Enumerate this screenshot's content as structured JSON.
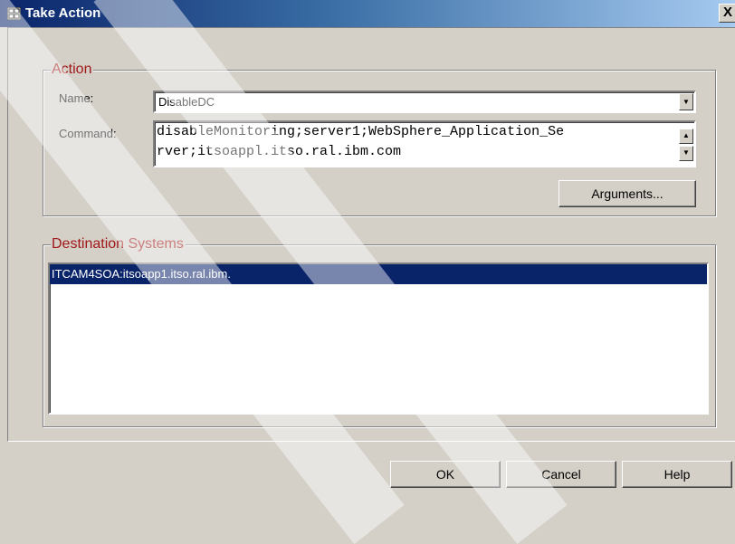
{
  "window": {
    "title": "Take Action",
    "close_glyph": "X"
  },
  "action_group": {
    "legend": "Action",
    "name_label": "Name:",
    "name_value": "DisableDC",
    "command_label": "Command:",
    "command_line1": "disableMonitoring;server1;WebSphere_Application_Se",
    "command_line2": "rver;itsoappl.itso.ral.ibm.com",
    "arguments_label": "Arguments..."
  },
  "destination_group": {
    "legend": "Destination Systems",
    "items": [
      "ITCAM4SOA:itsoapp1.itso.ral.ibm."
    ]
  },
  "buttons": {
    "ok": "OK",
    "cancel": "Cancel",
    "help": "Help"
  },
  "icons": [
    "window-icon",
    "close-icon",
    "dropdown-arrow-icon",
    "scroll-up-icon",
    "scroll-down-icon"
  ]
}
